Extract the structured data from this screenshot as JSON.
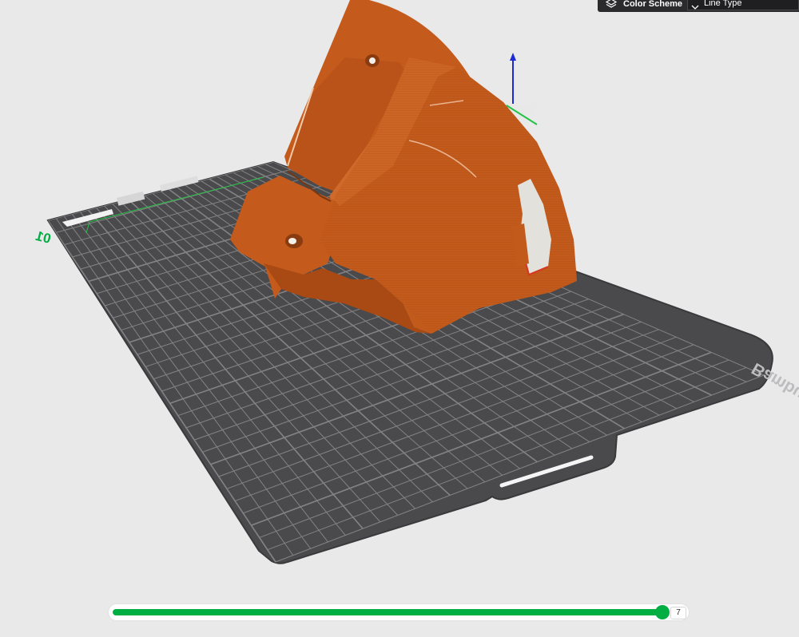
{
  "plate": {
    "label": "Bambu Textured PEI Plate",
    "plate_number": "01",
    "color": "#4a4a4c",
    "grid_color": "#8e8e90",
    "edge_color": "#3a3a3c"
  },
  "model": {
    "color": "#c45a1c",
    "shade_color": "#a94a14",
    "highlight_color": "#d8702f"
  },
  "gizmo": {
    "z_axis_color": "#1d2ad6",
    "x_axis_color": "#22c445"
  },
  "color_scheme": {
    "label": "Color Scheme",
    "icon": "layers-icon",
    "value": "Line Type"
  },
  "layer_slider": {
    "value": "7",
    "progress_fraction": 0.99,
    "accent": "#00ae42"
  }
}
